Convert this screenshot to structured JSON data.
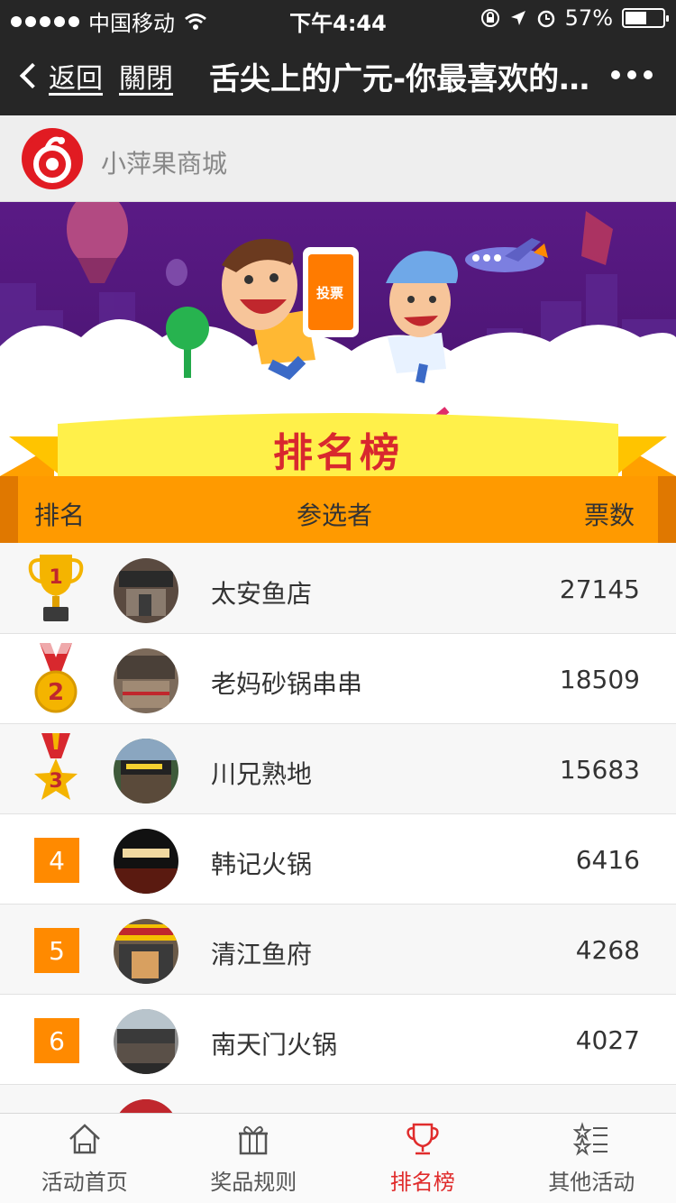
{
  "status": {
    "carrier": "中国移动",
    "time": "下午4:44",
    "battery_text": "57%",
    "battery_level": 0.57
  },
  "nav": {
    "back_label": "返回",
    "close_label": "關閉",
    "title": "舌尖上的广元-你最喜欢的美食店"
  },
  "shop": {
    "name": "小萍果商城",
    "brand_color": "#e11b22"
  },
  "banner": {
    "badge_text": "投票",
    "ribbon_title": "排名榜"
  },
  "table": {
    "col_rank": "排名",
    "col_name": "参选者",
    "col_votes": "票数",
    "rows": [
      {
        "rank": "1",
        "icon": "trophy-icon",
        "name": "太安鱼店",
        "votes": "27145"
      },
      {
        "rank": "2",
        "icon": "medal-2-icon",
        "name": "老妈砂锅串串",
        "votes": "18509"
      },
      {
        "rank": "3",
        "icon": "medal-3-icon",
        "name": "川兄熟地",
        "votes": "15683"
      },
      {
        "rank": "4",
        "icon": "",
        "name": "韩记火锅",
        "votes": "6416"
      },
      {
        "rank": "5",
        "icon": "",
        "name": "清江鱼府",
        "votes": "4268"
      },
      {
        "rank": "6",
        "icon": "",
        "name": "南天门火锅",
        "votes": "4027"
      }
    ]
  },
  "tabs": [
    {
      "label": "活动首页",
      "icon": "home-icon"
    },
    {
      "label": "奖品规则",
      "icon": "gift-icon"
    },
    {
      "label": "排名榜",
      "icon": "trophy-icon",
      "active": true
    },
    {
      "label": "其他活动",
      "icon": "star-list-icon"
    }
  ],
  "colors": {
    "accent": "#e02c2c",
    "rank_orange": "#ff8a00",
    "header_orange": "#ff9a00",
    "banner_purple": "#4a1572",
    "ribbon_yellow": "#fff04a"
  }
}
